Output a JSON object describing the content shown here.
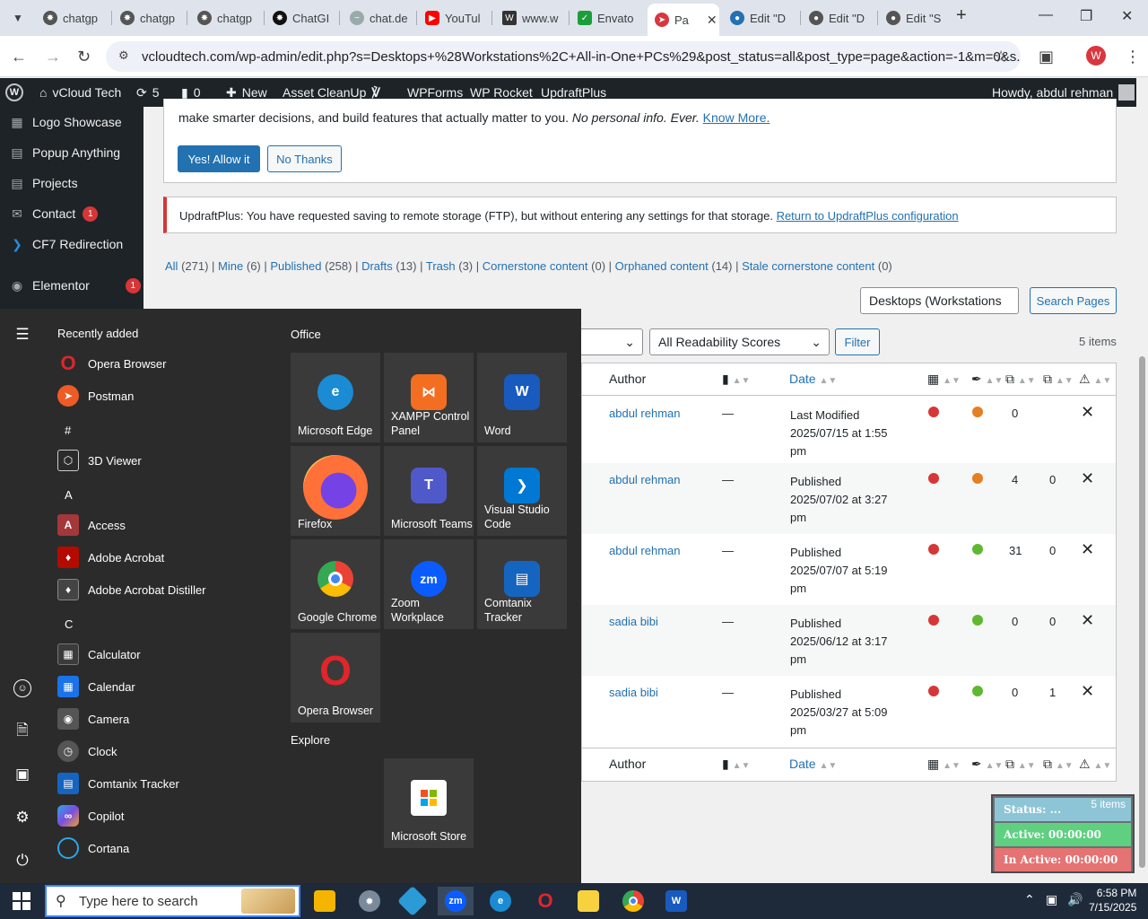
{
  "browser": {
    "tabs": [
      {
        "label": "chatgp",
        "icon": "chatgpt-icon"
      },
      {
        "label": "chatgp",
        "icon": "chatgpt-icon"
      },
      {
        "label": "chatgp",
        "icon": "chatgpt-icon"
      },
      {
        "label": "ChatGI",
        "icon": "chatgpt-icon"
      },
      {
        "label": "chat.de",
        "icon": "chat-icon"
      },
      {
        "label": "YouTul",
        "icon": "youtube-icon"
      },
      {
        "label": "www.w",
        "icon": "w-icon"
      },
      {
        "label": "Envato",
        "icon": "envato-icon"
      },
      {
        "label": "Pa",
        "icon": "vcloud-icon"
      },
      {
        "label": "Edit \"D",
        "icon": "edit-icon"
      },
      {
        "label": "Edit \"D",
        "icon": "edit-icon"
      },
      {
        "label": "Edit \"S",
        "icon": "edit-icon"
      }
    ],
    "url": "vcloudtech.com/wp-admin/edit.php?s=Desktops+%28Workstations%2C+All-in-One+PCs%29&post_status=all&post_type=page&action=-1&m=0&s...",
    "profile_initial": "W"
  },
  "adminbar": {
    "site": "vCloud Tech",
    "updates": "5",
    "comments": "0",
    "new": "New",
    "asset_cleanup": "Asset CleanUp",
    "wpforms": "WPForms",
    "wprocket": "WP Rocket",
    "updraft": "UpdraftPlus",
    "howdy": "Howdy, abdul rehman"
  },
  "sidebar": {
    "items": [
      {
        "label": "Logo Showcase"
      },
      {
        "label": "Popup Anything"
      },
      {
        "label": "Projects"
      },
      {
        "label": "Contact",
        "badge": "1"
      },
      {
        "label": "CF7 Redirection"
      },
      {
        "label": "Elementor",
        "badge": "1"
      }
    ]
  },
  "notice1": {
    "text": "make smarter decisions, and build features that actually matter to you.",
    "italic": "No personal info. Ever.",
    "link": "Know More.",
    "allow": "Yes! Allow it",
    "deny": "No Thanks"
  },
  "notice2": {
    "text": "UpdraftPlus: You have requested saving to remote storage (FTP), but without entering any settings for that storage.",
    "link": "Return to UpdraftPlus configuration"
  },
  "filters": {
    "all": "All",
    "all_count": "(271)",
    "mine": "Mine",
    "mine_count": "(6)",
    "published": "Published",
    "published_count": "(258)",
    "drafts": "Drafts",
    "drafts_count": "(13)",
    "trash": "Trash",
    "trash_count": "(3)",
    "cornerstone": "Cornerstone content",
    "cornerstone_count": "(0)",
    "orphaned": "Orphaned content",
    "orphaned_count": "(14)",
    "stale": "Stale cornerstone content",
    "stale_count": "(0)"
  },
  "search": {
    "value": "Desktops (Workstations",
    "button": "Search Pages"
  },
  "tablenav": {
    "readability": "All Readability Scores",
    "filter": "Filter",
    "items": "5 items",
    "items_bottom": "5 items"
  },
  "table": {
    "headers": {
      "author": "Author",
      "date": "Date"
    },
    "rows": [
      {
        "author": "abdul rehman",
        "comments": "—",
        "status": "Last Modified",
        "date": "2025/07/15 at 1:55",
        "time": "pm",
        "seo": "#d63638",
        "read": "#e67e22",
        "links_in": "0",
        "links_out": ""
      },
      {
        "author": "abdul rehman",
        "comments": "—",
        "status": "Published",
        "date": "2025/07/02 at 3:27",
        "time": "pm",
        "seo": "#d63638",
        "read": "#e67e22",
        "links_in": "4",
        "links_out": "0"
      },
      {
        "author": "abdul rehman",
        "comments": "—",
        "status": "Published",
        "date": "2025/07/07 at 5:19",
        "time": "pm",
        "seo": "#d63638",
        "read": "#5fb832",
        "links_in": "31",
        "links_out": "0"
      },
      {
        "author": "sadia bibi",
        "comments": "—",
        "status": "Published",
        "date": "2025/06/12 at 3:17",
        "time": "pm",
        "seo": "#d63638",
        "read": "#5fb832",
        "links_in": "0",
        "links_out": "0"
      },
      {
        "author": "sadia bibi",
        "comments": "—",
        "status": "Published",
        "date": "2025/03/27 at 5:09",
        "time": "pm",
        "seo": "#d63638",
        "read": "#5fb832",
        "links_in": "0",
        "links_out": "1"
      }
    ]
  },
  "timer": {
    "status": "Status: ...",
    "active": "Active: 00:00:00",
    "inactive": "In Active: 00:00:00"
  },
  "startmenu": {
    "recently_added": "Recently added",
    "office": "Office",
    "explore": "Explore",
    "apps": [
      {
        "label": "Opera Browser",
        "color": "#e0252b"
      },
      {
        "label": "Postman",
        "color": "#ef5b25"
      },
      {
        "label": "#",
        "letter": true
      },
      {
        "label": "3D Viewer",
        "color": "#2b2b2b"
      },
      {
        "label": "A",
        "letter": true
      },
      {
        "label": "Access",
        "color": "#a4373a"
      },
      {
        "label": "Adobe Acrobat",
        "color": "#b30b00"
      },
      {
        "label": "Adobe Acrobat Distiller",
        "color": "#444444"
      },
      {
        "label": "C",
        "letter": true
      },
      {
        "label": "Calculator",
        "color": "#3b3b3b"
      },
      {
        "label": "Calendar",
        "color": "#1a73e8"
      },
      {
        "label": "Camera",
        "color": "#555555"
      },
      {
        "label": "Clock",
        "color": "#555555"
      },
      {
        "label": "Comtanix Tracker",
        "color": "#1565c0"
      },
      {
        "label": "Copilot",
        "color": "#7b4de0"
      },
      {
        "label": "Cortana",
        "color": "#2b2b2b"
      }
    ],
    "tiles": [
      {
        "label": "Microsoft Edge",
        "color": "#1b8bd3"
      },
      {
        "label": "XAMPP Control Panel",
        "color": "#f36e21"
      },
      {
        "label": "Word",
        "color": "#185abd"
      },
      {
        "label": "Firefox",
        "color": "#ff7139"
      },
      {
        "label": "Microsoft Teams",
        "color": "#5059c9"
      },
      {
        "label": "Visual Studio Code",
        "color": "#0078d4"
      },
      {
        "label": "Google Chrome",
        "color": "#ffffff"
      },
      {
        "label": "Zoom Workplace",
        "color": "#0b5cff"
      },
      {
        "label": "Comtanix Tracker",
        "color": "#1565c0"
      },
      {
        "label": "Opera Browser",
        "color": "#e0252b"
      }
    ],
    "explore_tiles": [
      {
        "label": "Microsoft Store",
        "color": "#ffffff"
      }
    ]
  },
  "taskbar": {
    "search_placeholder": "Type here to search",
    "time": "6:58 PM",
    "date": "7/15/2025"
  }
}
